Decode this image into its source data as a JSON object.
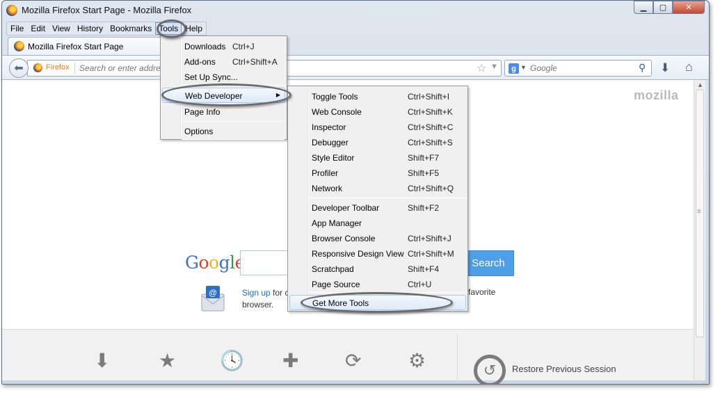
{
  "window": {
    "title": "Mozilla Firefox Start Page - Mozilla Firefox",
    "controls": {
      "minimize": "▁",
      "maximize": "▢",
      "close": "✕"
    }
  },
  "menubar": {
    "items": [
      "File",
      "Edit",
      "View",
      "History",
      "Bookmarks",
      "Tools",
      "Help"
    ],
    "active": "Tools"
  },
  "tab": {
    "title": "Mozilla Firefox Start Page"
  },
  "navbar": {
    "identity": "Firefox",
    "url_placeholder": "Search or enter address",
    "search_engine": "g",
    "search_placeholder": "Google"
  },
  "tools_menu": [
    {
      "label": "Downloads",
      "accel": "Ctrl+J"
    },
    {
      "label": "Add-ons",
      "accel": "Ctrl+Shift+A"
    },
    {
      "label": "Set Up Sync...",
      "accel": ""
    },
    {
      "label": "Web Developer",
      "accel": "",
      "submenu": true
    },
    {
      "label": "Page Info",
      "accel": ""
    },
    {
      "label": "Options",
      "accel": ""
    }
  ],
  "webdev_menu": [
    {
      "label": "Toggle Tools",
      "accel": "Ctrl+Shift+I"
    },
    {
      "label": "Web Console",
      "accel": "Ctrl+Shift+K"
    },
    {
      "label": "Inspector",
      "accel": "Ctrl+Shift+C"
    },
    {
      "label": "Debugger",
      "accel": "Ctrl+Shift+S"
    },
    {
      "label": "Style Editor",
      "accel": "Shift+F7"
    },
    {
      "label": "Profiler",
      "accel": "Shift+F5"
    },
    {
      "label": "Network",
      "accel": "Ctrl+Shift+Q"
    },
    {
      "label": "Developer Toolbar",
      "accel": "Shift+F2"
    },
    {
      "label": "App Manager",
      "accel": ""
    },
    {
      "label": "Browser Console",
      "accel": "Ctrl+Shift+J"
    },
    {
      "label": "Responsive Design View",
      "accel": "Ctrl+Shift+M"
    },
    {
      "label": "Scratchpad",
      "accel": "Shift+F4"
    },
    {
      "label": "Page Source",
      "accel": "Ctrl+U"
    },
    {
      "label": "Get More Tools",
      "accel": ""
    }
  ],
  "content": {
    "mozilla_logo": "mozilla",
    "google_logo": [
      "G",
      "o",
      "o",
      "g",
      "l",
      "e"
    ],
    "google_colors": [
      "#3b6fd8",
      "#d9402d",
      "#f3b21d",
      "#3b6fd8",
      "#2f9a48",
      "#d9402d"
    ],
    "search_button": "Search",
    "signup_link": "Sign up",
    "signup_rest": "for c",
    "signup_line2": "browser.",
    "favorite_text": "favorite",
    "restore_label": "Restore Previous Session"
  },
  "launchers": [
    {
      "name": "downloads-launcher",
      "icon": "⬇"
    },
    {
      "name": "bookmarks-launcher",
      "icon": "★"
    },
    {
      "name": "history-launcher",
      "icon": "🕓"
    },
    {
      "name": "addons-launcher",
      "icon": "✚"
    },
    {
      "name": "sync-launcher",
      "icon": "⟳"
    },
    {
      "name": "settings-launcher",
      "icon": "⚙"
    }
  ],
  "colors": {
    "accent": "#4f9ee8",
    "identity": "#ef7b15",
    "oval": "#6b6b6b"
  }
}
